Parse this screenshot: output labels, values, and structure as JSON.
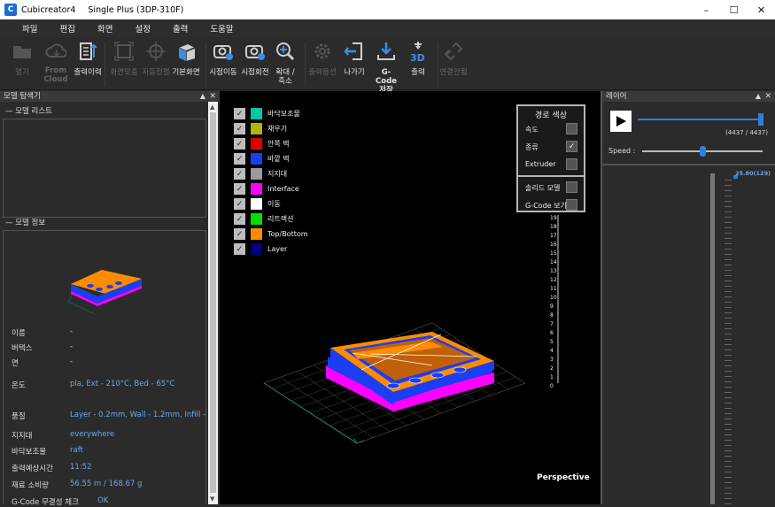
{
  "window": {
    "app_name": "Cubicreator4",
    "title": "Single Plus (3DP-310F)",
    "controls": [
      "minimize",
      "maximize",
      "close"
    ]
  },
  "menu": [
    "파일",
    "편집",
    "화면",
    "설정",
    "출력",
    "도움말"
  ],
  "toolbar": {
    "buttons": [
      {
        "id": "open",
        "label": "열기",
        "icon": "folder-icon",
        "enabled": false
      },
      {
        "id": "from_cloud",
        "label": "From Cloud",
        "icon": "cloud-download-icon",
        "enabled": false
      },
      {
        "id": "history",
        "label": "출력이력",
        "icon": "history-icon",
        "enabled": true
      },
      {
        "id": "fit_screen",
        "label": "화면맞춤",
        "icon": "fit-screen-icon",
        "enabled": false
      },
      {
        "id": "auto_arrange",
        "label": "자동정렬",
        "icon": "crosshair-icon",
        "enabled": false
      },
      {
        "id": "default_view",
        "label": "기본화면",
        "icon": "cube-icon",
        "enabled": true
      },
      {
        "id": "pan_view",
        "label": "시점이동",
        "icon": "camera-move-icon",
        "enabled": true
      },
      {
        "id": "rotate_view",
        "label": "시점회전",
        "icon": "camera-rotate-icon",
        "enabled": true
      },
      {
        "id": "zoom",
        "label": "확대 / 축소",
        "icon": "zoom-icon",
        "enabled": true
      },
      {
        "id": "print_options",
        "label": "출력옵션",
        "icon": "gear-icon",
        "enabled": false
      },
      {
        "id": "exit",
        "label": "나가기",
        "icon": "exit-icon",
        "enabled": true
      },
      {
        "id": "gcode_save",
        "label": "G-Code 저장",
        "icon": "download-icon",
        "enabled": true
      },
      {
        "id": "print",
        "label": "출력",
        "icon": "print-3d-icon",
        "enabled": true
      },
      {
        "id": "connect",
        "label": "연결안됨",
        "icon": "link-broken-icon",
        "enabled": false
      }
    ]
  },
  "left_panel": {
    "title": "모델 탐색기",
    "model_list_title": "모델 리스트",
    "model_info_title": "모델 정보",
    "info": [
      {
        "label": "이름",
        "value": "-"
      },
      {
        "label": "버텍스",
        "value": "-"
      },
      {
        "label": "면",
        "value": "-"
      },
      {
        "label": "온도",
        "value": "pla, Ext - 210°C, Bed - 65°C"
      },
      {
        "label": "품질",
        "value": "Layer - 0.2mm, Wall - 1.2mm, Infill -"
      },
      {
        "label": "지지대",
        "value": "everywhere"
      },
      {
        "label": "바닥보조물",
        "value": "raft"
      },
      {
        "label": "출력예상시간",
        "value": "11:52"
      },
      {
        "label": "재료 소비량",
        "value": "56.55 m / 168.67 g"
      },
      {
        "label": "G-Code 무결성 체크",
        "value": "OK"
      }
    ]
  },
  "viewport": {
    "legend": [
      {
        "label": "바닥보조물",
        "color": "#00c8a0",
        "checked": true
      },
      {
        "label": "채우기",
        "color": "#b4b400",
        "checked": true
      },
      {
        "label": "안쪽 벽",
        "color": "#e00000",
        "checked": true
      },
      {
        "label": "바깥 벽",
        "color": "#1a3ef0",
        "checked": true
      },
      {
        "label": "지지대",
        "color": "#9a9a9a",
        "checked": true
      },
      {
        "label": "Interface",
        "color": "#ff00ff",
        "checked": true
      },
      {
        "label": "이동",
        "color": "#ffffff",
        "checked": true
      },
      {
        "label": "리트랙션",
        "color": "#00e000",
        "checked": true
      },
      {
        "label": "Top/Bottom",
        "color": "#ff8c00",
        "checked": true
      },
      {
        "label": "Layer",
        "color": "#000080",
        "checked": true
      }
    ],
    "path_color": {
      "title": "경로 색상",
      "options": [
        {
          "label": "속도",
          "checked": false
        },
        {
          "label": "종류",
          "checked": true
        },
        {
          "label": "Extruder",
          "checked": false
        }
      ],
      "solid_model": {
        "label": "솔리드 모델",
        "checked": false
      },
      "gcode_view": {
        "label": "G-Code 보기",
        "checked": false
      }
    },
    "ruler": [
      "19",
      "18",
      "17",
      "16",
      "15",
      "14",
      "13",
      "12",
      "11",
      "10",
      "9",
      "8",
      "7",
      "6",
      "5",
      "4",
      "3",
      "2",
      "1",
      "0"
    ],
    "projection": "Perspective"
  },
  "right_panel": {
    "title": "레이어",
    "progress_text": "(4437 / 4437)",
    "progress": 1.0,
    "speed_label": "Speed :",
    "speed": 0.5,
    "layer_label": "25.80(129)"
  },
  "colors": {
    "accent": "#2f7fe0",
    "panel_bg": "#2b2b2b",
    "viewport_bg": "#000000"
  }
}
